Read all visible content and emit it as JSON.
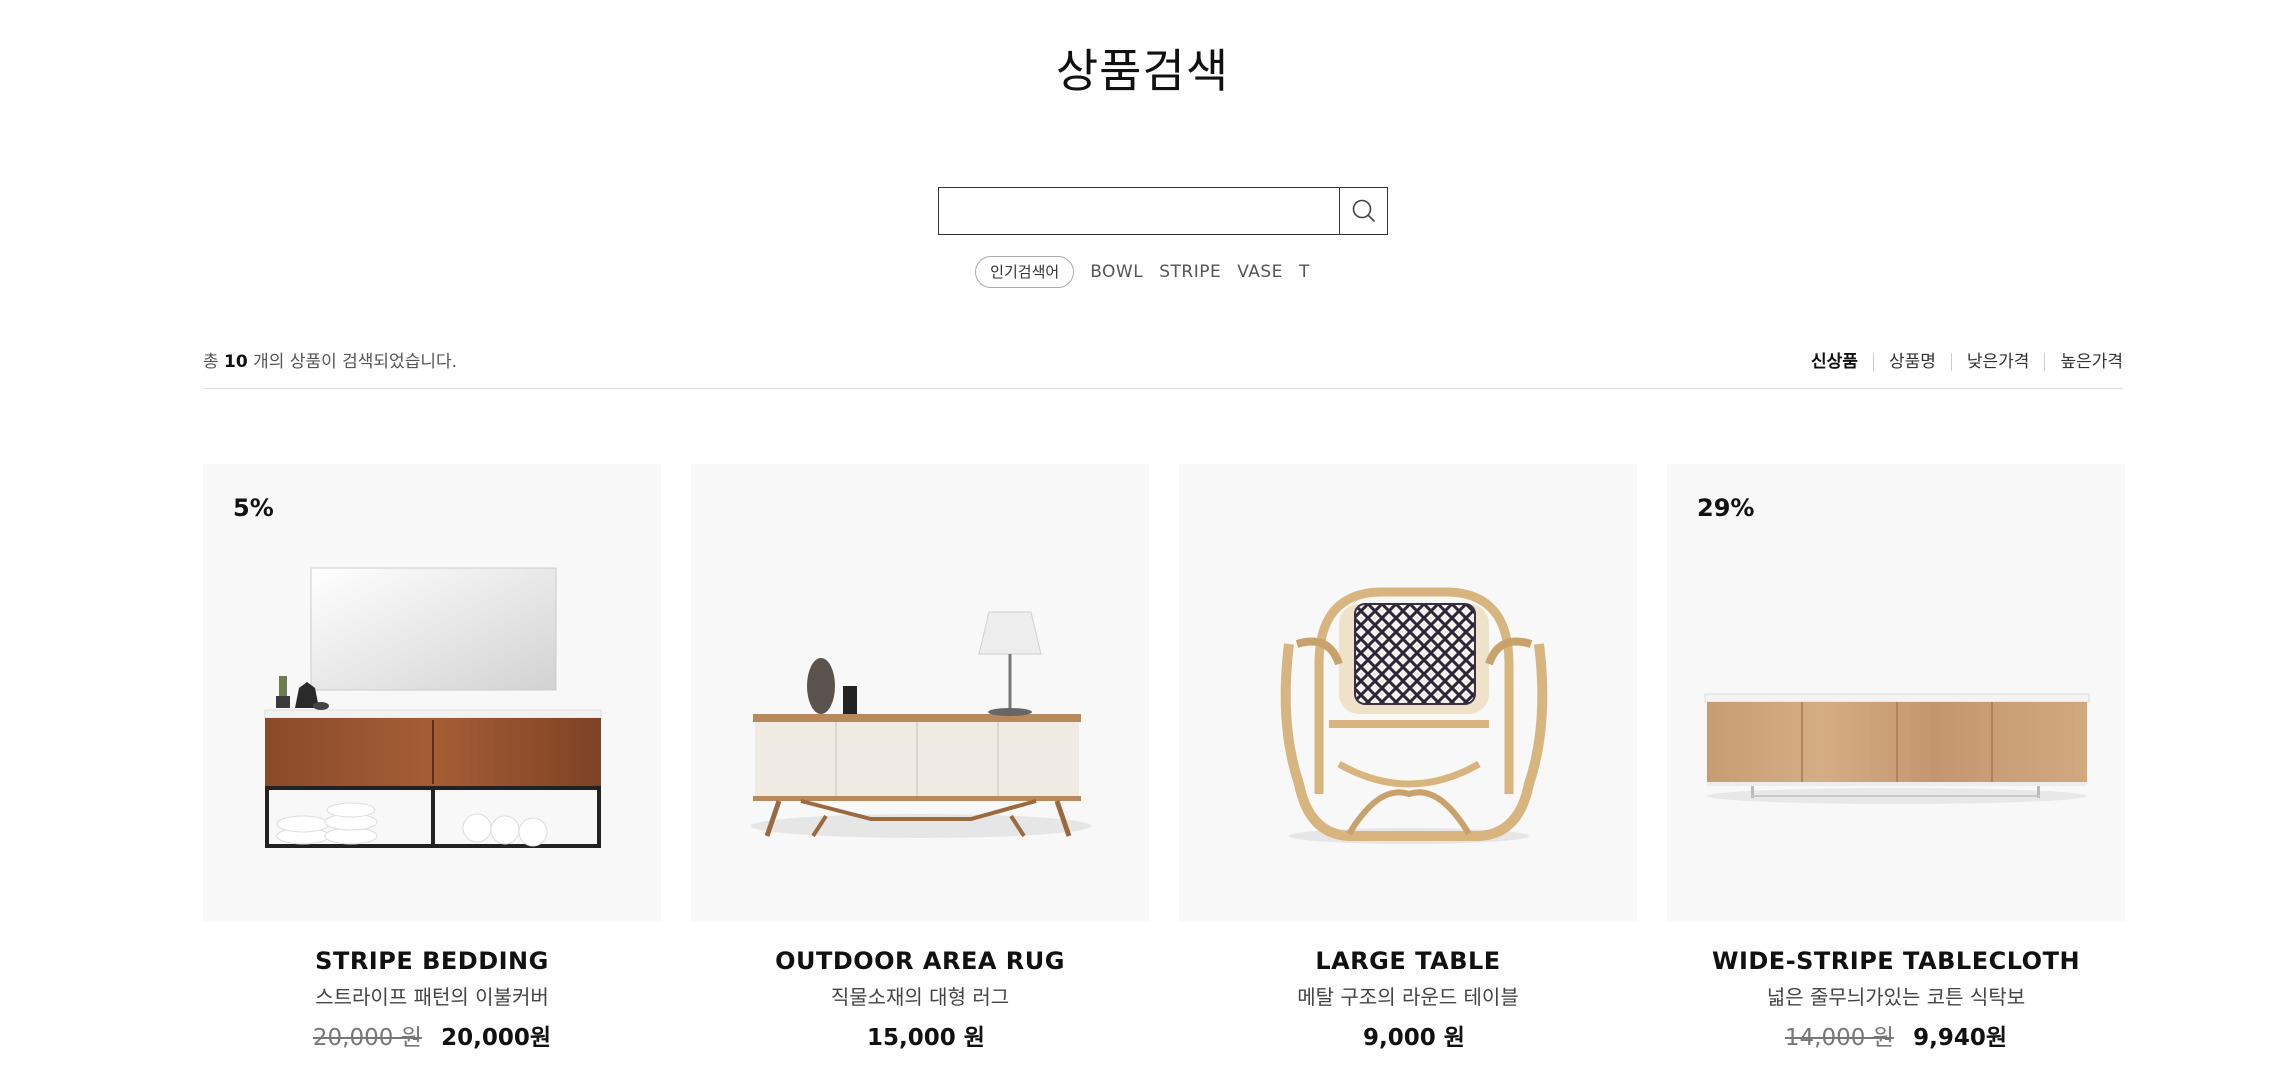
{
  "page": {
    "title": "상품검색"
  },
  "search": {
    "value": "",
    "placeholder": ""
  },
  "popular": {
    "badge": "인기검색어",
    "keywords": [
      "BOWL",
      "STRIPE",
      "VASE",
      "T"
    ]
  },
  "results": {
    "prefix": "총 ",
    "count": "10",
    "suffix": " 개의 상품이 검색되었습니다."
  },
  "sort": {
    "options": [
      "신상품",
      "상품명",
      "낮은가격",
      "높은가격"
    ],
    "active": "신상품"
  },
  "products": [
    {
      "name": "STRIPE BEDDING",
      "desc": "스트라이프 패턴의 이불커버",
      "discount": "5%",
      "original_price": "20,000 원",
      "price": "20,000원",
      "image_icon": "bathroom-vanity-image"
    },
    {
      "name": "OUTDOOR AREA RUG",
      "desc": "직물소재의 대형 러그",
      "discount": "",
      "original_price": "",
      "price": "15,000 원",
      "image_icon": "sideboard-with-lamp-image"
    },
    {
      "name": "LARGE TABLE",
      "desc": "메탈 구조의 라운드 테이블",
      "discount": "",
      "original_price": "",
      "price": "9,000 원",
      "image_icon": "rattan-chair-image"
    },
    {
      "name": "WIDE-STRIPE TABLECLOTH",
      "desc": "넓은 줄무늬가있는 코튼 식탁보",
      "discount": "29%",
      "original_price": "14,000 원",
      "price": "9,940원",
      "image_icon": "wooden-tv-cabinet-image"
    }
  ]
}
